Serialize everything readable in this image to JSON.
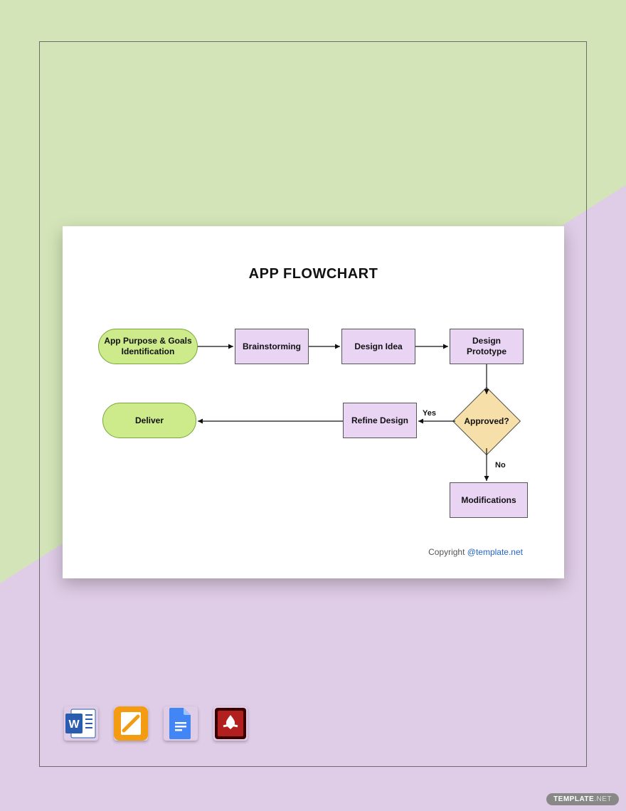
{
  "title": "APP FLOWCHART",
  "nodes": {
    "start": "App Purpose & Goals Identification",
    "brainstorm": "Brainstorming",
    "idea": "Design Idea",
    "prototype": "Design Prototype",
    "decision": "Approved?",
    "refine": "Refine Design",
    "deliver": "Deliver",
    "mods": "Modifications"
  },
  "edges": {
    "yes": "Yes",
    "no": "No"
  },
  "copyright": {
    "text": "Copyright ",
    "link": "@template.net"
  },
  "formats": [
    "Word",
    "Pages",
    "Google Docs",
    "PDF"
  ],
  "watermark": {
    "brand": "TEMPLATE",
    "tld": ".NET"
  }
}
